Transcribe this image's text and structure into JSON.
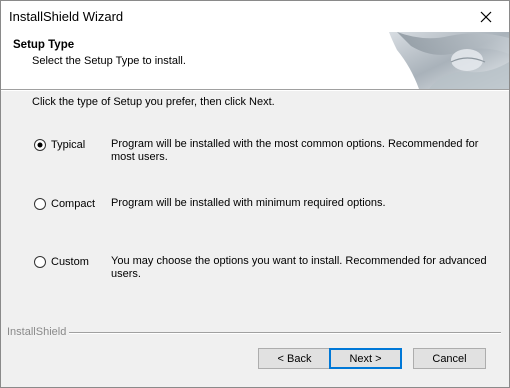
{
  "window": {
    "title": "InstallShield Wizard"
  },
  "header": {
    "title": "Setup Type",
    "subtitle": "Select the Setup Type to install."
  },
  "instruction": "Click the type of Setup you prefer, then click Next.",
  "options": [
    {
      "label": "Typical",
      "description": "Program will be installed with the most common options.  Recommended for most users.",
      "selected": true
    },
    {
      "label": "Compact",
      "description": "Program will be installed with minimum required options.",
      "selected": false
    },
    {
      "label": "Custom",
      "description": "You may choose the options you want to install. Recommended for advanced users.",
      "selected": false
    }
  ],
  "brand": "InstallShield",
  "buttons": {
    "back": "< Back",
    "next": "Next >",
    "cancel": "Cancel"
  },
  "icons": {
    "close": "close-icon",
    "header_art": "header-graphic"
  }
}
